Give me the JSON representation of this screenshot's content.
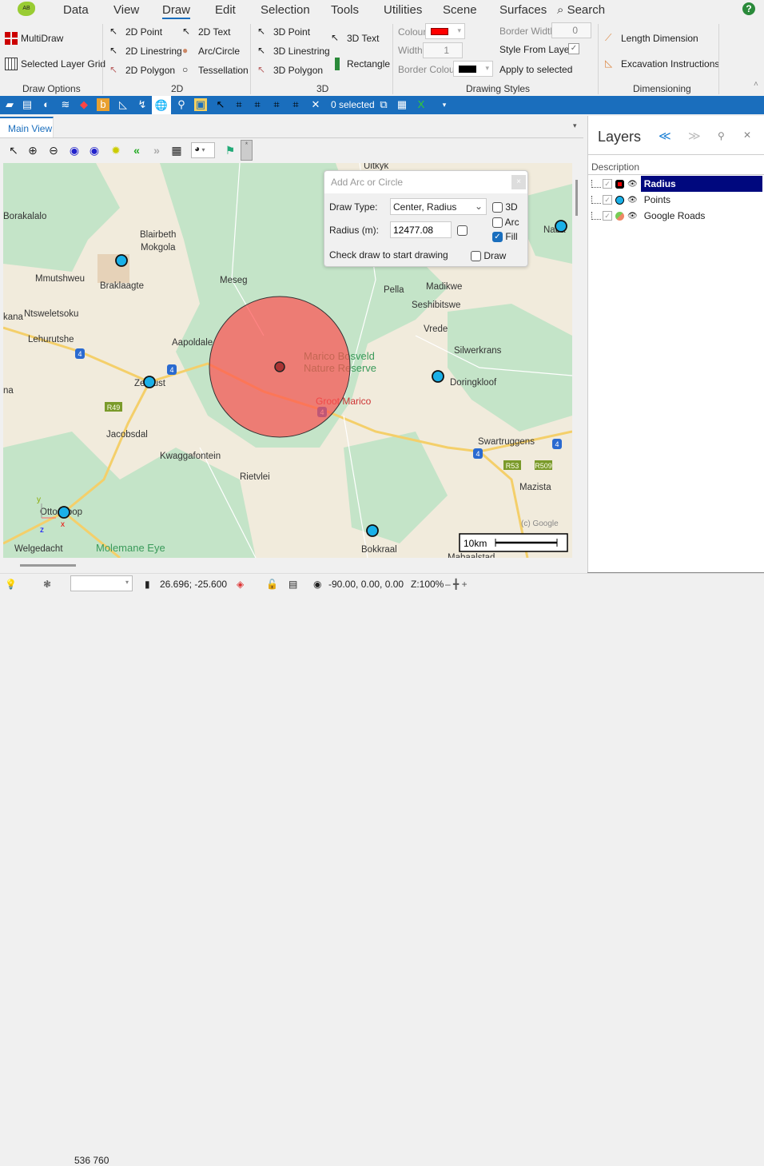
{
  "menu": {
    "items": [
      "Data",
      "View",
      "Draw",
      "Edit",
      "Selection",
      "Tools",
      "Utilities",
      "Scene",
      "Surfaces"
    ],
    "active": "Draw",
    "search": "Search"
  },
  "ribbon": {
    "draw_options": {
      "items": [
        "MultiDraw",
        "Selected Layer Grid"
      ],
      "label": "Draw Options"
    },
    "2d": {
      "items": [
        "2D Point",
        "2D Linestring",
        "2D Polygon",
        "2D Text",
        "Arc/Circle",
        "Tessellation"
      ],
      "label": "2D"
    },
    "3d": {
      "items": [
        "3D Point",
        "3D Linestring",
        "3D Polygon",
        "3D Text",
        "Rectangle"
      ],
      "label": "3D"
    },
    "styles": {
      "colour_label": "Colour",
      "colour": "#ff0000",
      "width_label": "Width",
      "width": "1",
      "border_colour_label": "Border Colour",
      "border_colour": "#000000",
      "border_width_label": "Border Width",
      "border_width": "0",
      "style_from_layer": "Style From Layer",
      "style_from_layer_checked": true,
      "apply": "Apply to selected",
      "label": "Drawing Styles"
    },
    "dimensioning": {
      "items": [
        "Length Dimension",
        "Excavation Instructions"
      ],
      "label": "Dimensioning"
    }
  },
  "toolbar": {
    "selected": "0 selected"
  },
  "tabs": {
    "main": "Main View"
  },
  "map": {
    "labels": [
      "Uitkyk",
      "Borakalalo",
      "Blairbeth",
      "Mokgola",
      "Mmutshweu",
      "Meseg",
      "Braklaagte",
      "Pella",
      "Madikwe",
      "Naba",
      "Ntsweletsoku",
      "Seshibitswe",
      "kana",
      "Lehurutshe",
      "Vrede",
      "Aapoldale",
      "Silwerkrans",
      "Zeerust",
      "Doringkloof",
      "na",
      "Jacobsdal",
      "Swartruggens",
      "Kwaggafontein",
      "Rietvlei",
      "Mazista",
      "Ottoshoop",
      "Welgedacht",
      "Bokkraal",
      "Mabaalstad"
    ],
    "green_labels": [
      "Marico Bosveld",
      "Nature Reserve",
      "Molemane Eye"
    ],
    "red_label": "Groot Marico",
    "shields": [
      "4",
      "4",
      "4",
      "4",
      "4"
    ],
    "yellow_shields": [
      "R49",
      "R53",
      "R509"
    ],
    "copyright": "(c) Google",
    "scale": "10km",
    "axes": {
      "x": "x",
      "y": "y",
      "z": "z"
    },
    "circle_fill": "#ff5050",
    "point_color": "#1ab0e8"
  },
  "dialog": {
    "title": "Add Arc or Circle",
    "draw_type_label": "Draw Type:",
    "draw_type": "Center, Radius",
    "radius_label": "Radius (m):",
    "radius": "12477.08",
    "hint": "Check draw to start drawing",
    "opt_3d": "3D",
    "opt_arc": "Arc",
    "opt_fill": "Fill",
    "opt_draw": "Draw",
    "fill_checked": true
  },
  "layers": {
    "title": "Layers",
    "column": "Description",
    "items": [
      {
        "name": "Radius",
        "selected": true
      },
      {
        "name": "Points"
      },
      {
        "name": "Google Roads"
      }
    ]
  },
  "status": {
    "scale": "536 760",
    "coords": "26.696; -25.600",
    "rotation": "-90.00, 0.00, 0.00",
    "zoom": "Z:100%"
  }
}
